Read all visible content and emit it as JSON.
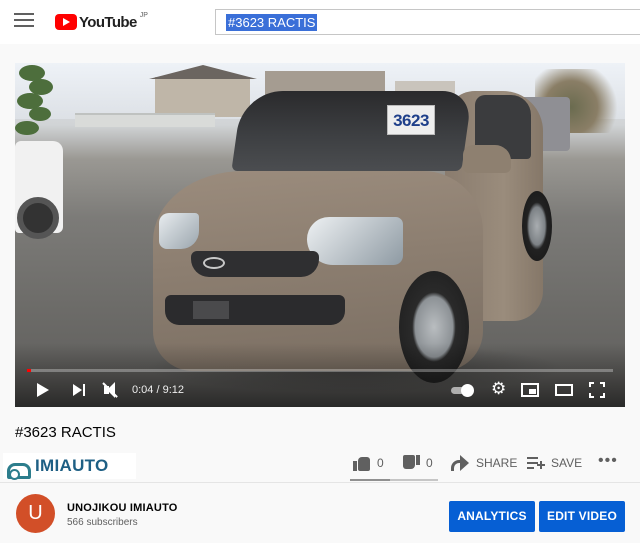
{
  "header": {
    "logo_text": "YouTube",
    "logo_region": "JP",
    "search_value": "#3623 RACTIS"
  },
  "player": {
    "windshield_sign": "3623",
    "time": "0:04 / 9:12",
    "progress": 0.007
  },
  "video": {
    "title": "#3623 RACTIS",
    "watermark": "IMIAUTO"
  },
  "actions": {
    "like_count": "0",
    "dislike_count": "0",
    "share_label": "SHARE",
    "save_label": "SAVE"
  },
  "channel": {
    "avatar_letter": "U",
    "name": "UNOJIKOU IMIAUTO",
    "subscribers": "566 subscribers",
    "analytics_label": "ANALYTICS",
    "edit_label": "EDIT VIDEO"
  },
  "colors": {
    "accent": "#065fd4",
    "brand_red": "#ff0000",
    "avatar": "#d24f28"
  }
}
